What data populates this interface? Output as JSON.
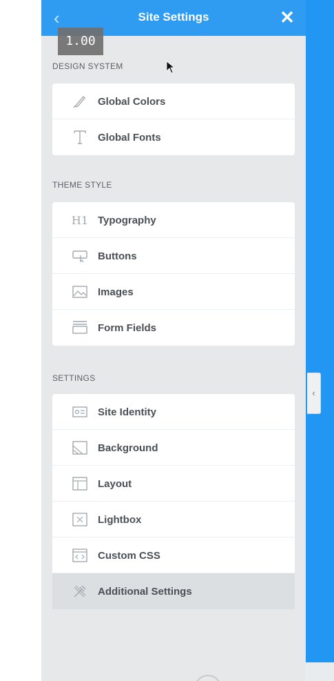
{
  "header": {
    "title": "Site Settings",
    "back_icon": "chevron-left-icon",
    "close_icon": "close-icon",
    "accent_color": "#2f9cf1"
  },
  "version_badge": "1.00",
  "sections": [
    {
      "label": "DESIGN SYSTEM",
      "items": [
        {
          "label": "Global Colors",
          "icon": "brush-icon"
        },
        {
          "label": "Global Fonts",
          "icon": "typeface-icon"
        }
      ]
    },
    {
      "label": "THEME STYLE",
      "items": [
        {
          "label": "Typography",
          "icon": "heading-icon",
          "icon_text": "H1"
        },
        {
          "label": "Buttons",
          "icon": "button-pointer-icon"
        },
        {
          "label": "Images",
          "icon": "image-icon"
        },
        {
          "label": "Form Fields",
          "icon": "form-fields-icon"
        }
      ]
    },
    {
      "label": "SETTINGS",
      "items": [
        {
          "label": "Site Identity",
          "icon": "id-card-icon"
        },
        {
          "label": "Background",
          "icon": "background-icon"
        },
        {
          "label": "Layout",
          "icon": "layout-icon"
        },
        {
          "label": "Lightbox",
          "icon": "lightbox-icon"
        },
        {
          "label": "Custom CSS",
          "icon": "code-icon"
        },
        {
          "label": "Additional Settings",
          "icon": "tools-icon",
          "hover": true
        }
      ]
    }
  ],
  "collapse_handle_icon": "chevron-left-icon",
  "canvas_color": "#2196f3"
}
